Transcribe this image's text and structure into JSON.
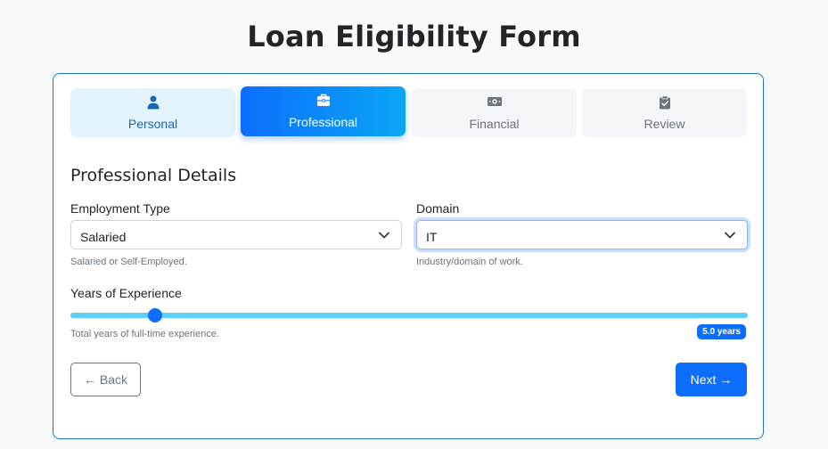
{
  "page": {
    "title": "Loan Eligibility Form"
  },
  "steps": [
    {
      "label": "Personal",
      "icon": "person-icon",
      "state": "completed"
    },
    {
      "label": "Professional",
      "icon": "briefcase-icon",
      "state": "active"
    },
    {
      "label": "Financial",
      "icon": "money-icon",
      "state": "pending"
    },
    {
      "label": "Review",
      "icon": "clipboard-check-icon",
      "state": "pending"
    }
  ],
  "section": {
    "title": "Professional Details"
  },
  "employment": {
    "label": "Employment Type",
    "value": "Salaried",
    "help": "Salaried or Self-Employed."
  },
  "domain": {
    "label": "Domain",
    "value": "IT",
    "help": "Industry/domain of work."
  },
  "experience": {
    "label": "Years of Experience",
    "value": 5.0,
    "max": 40,
    "value_label": "5.0 years",
    "help": "Total years of full-time experience."
  },
  "nav": {
    "back_label": "← Back",
    "next_label": "Next →"
  },
  "colors": {
    "primary": "#0d6efd",
    "accent_gradient_end": "#0aa6f5",
    "track": "#5ccff5",
    "completed_step_bg": "#e2f3fd",
    "card_border": "#1d72d8"
  }
}
